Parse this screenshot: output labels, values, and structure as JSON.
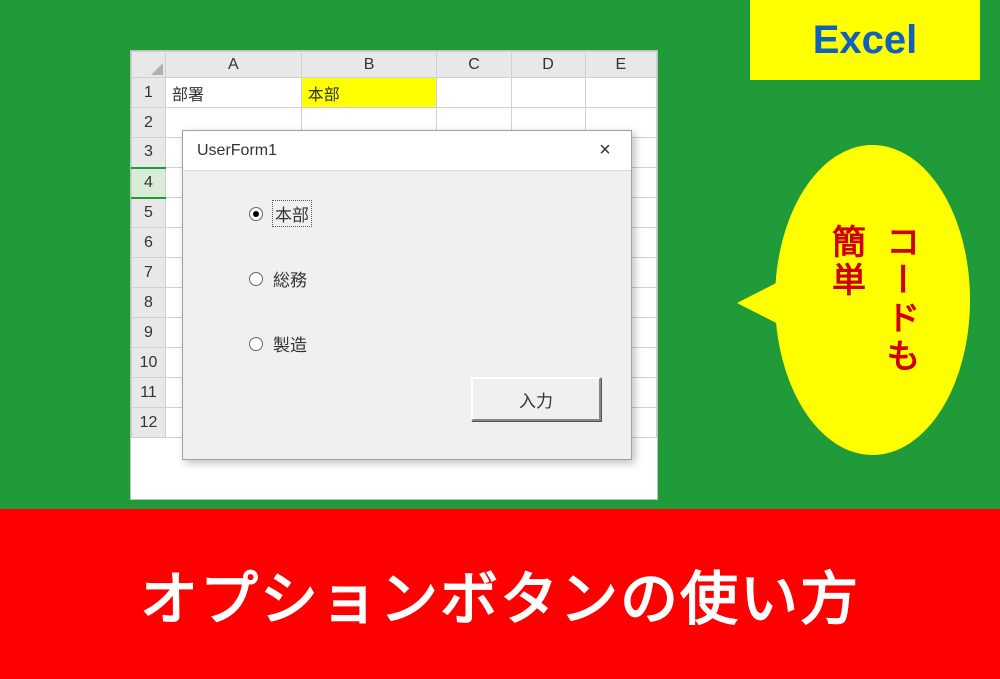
{
  "badge": {
    "label": "Excel"
  },
  "bubble": {
    "line1": "コードも",
    "line2": "簡単"
  },
  "sheet": {
    "columns": [
      "A",
      "B",
      "C",
      "D",
      "E"
    ],
    "rows": [
      "1",
      "2",
      "3",
      "4",
      "5",
      "6",
      "7",
      "8",
      "9",
      "10",
      "11",
      "12"
    ],
    "cells": {
      "a1": "部署",
      "b1": "本部"
    },
    "highlighted_cell": "B1",
    "selected_row": "4"
  },
  "userform": {
    "title": "UserForm1",
    "close_label": "×",
    "options": [
      {
        "label": "本部",
        "checked": true
      },
      {
        "label": "総務",
        "checked": false
      },
      {
        "label": "製造",
        "checked": false
      }
    ],
    "submit_label": "入力"
  },
  "banner": {
    "text": "オプションボタンの使い方"
  }
}
